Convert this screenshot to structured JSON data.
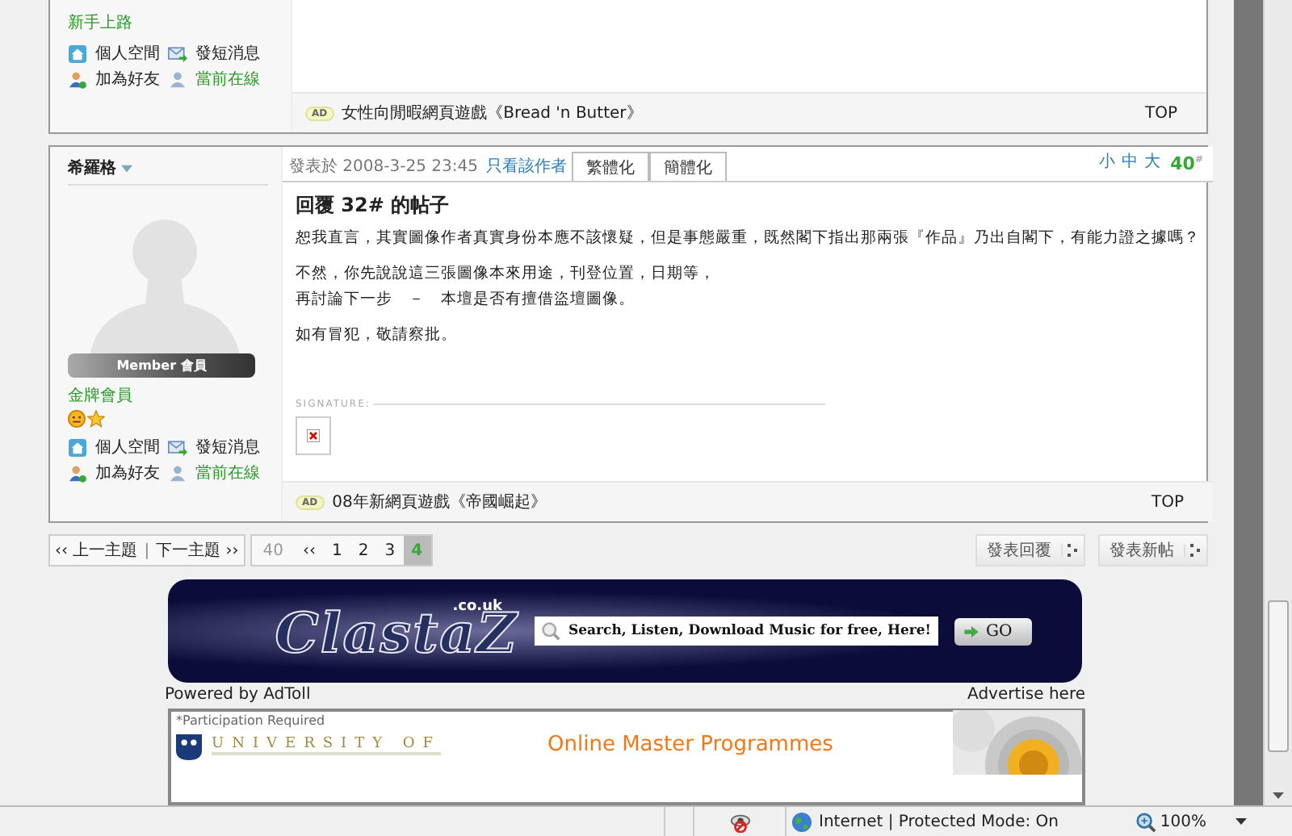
{
  "prev_post": {
    "rank": "新手上路",
    "actions": [
      {
        "kind": "home",
        "label": "個人空間"
      },
      {
        "kind": "mail",
        "label": "發短消息"
      },
      {
        "kind": "add",
        "label": "加為好友"
      },
      {
        "kind": "online",
        "label": "當前在線"
      }
    ],
    "ad": {
      "badge": "AD",
      "text": "女性向閒暇網頁遊戲《Bread 'n Butter》"
    },
    "top": "TOP"
  },
  "post": {
    "author": "希羅格",
    "posted": "發表於 2008-3-25 23:45",
    "author_only": "只看該作者",
    "convert_tabs": [
      "繁體化",
      "簡體化"
    ],
    "font_sizes": [
      "小",
      "中",
      "大"
    ],
    "floor": "40",
    "floor_mark": "#",
    "rank_badge": "Member 會員",
    "rank": "金牌會員",
    "actions": [
      {
        "kind": "home",
        "label": "個人空間"
      },
      {
        "kind": "mail",
        "label": "發短消息"
      },
      {
        "kind": "add",
        "label": "加為好友"
      },
      {
        "kind": "online",
        "label": "當前在線"
      }
    ],
    "title": "回覆 32# 的帖子",
    "paragraphs": [
      [
        "恕我直言，其實圖像作者真實身份本應不該懷疑，但是事態嚴重，既然閣下指出那兩張『作品』乃出自閣下，有能力證之據嗎？"
      ],
      [
        "不然，你先說說這三張圖像本來用途，刊登位置，日期等，",
        "再討論下一步　－　本壇是否有擅借盜壇圖像。"
      ],
      [
        "如有冒犯，敬請察批。"
      ]
    ],
    "signature_label": "SIGNATURE:",
    "ad": {
      "badge": "AD",
      "text": "08年新網頁遊戲《帝國崛起》"
    },
    "top": "TOP"
  },
  "thread_nav": [
    "‹‹ 上一主題",
    "下一主題 ››"
  ],
  "thread_nav_separator": "|",
  "pagination": {
    "total": "40",
    "first": "‹‹",
    "pages": [
      {
        "label": "1",
        "selected": false
      },
      {
        "label": "2",
        "selected": false
      },
      {
        "label": "3",
        "selected": false
      },
      {
        "label": "4",
        "selected": true
      }
    ]
  },
  "buttons": [
    "發表回覆",
    "發表新帖"
  ],
  "banner": {
    "logo": "ClastaZ",
    "domain": ".co.uk",
    "search": "Search, Listen, Download Music for free, Here!",
    "go": "GO"
  },
  "powered": "Powered by AdToll",
  "advertise": "Advertise here",
  "promo": {
    "note": "*Participation Required",
    "org": "UNIVERSITY OF",
    "headline": "Online Master Programmes"
  },
  "status_bar": {
    "zone": "Internet | Protected Mode: On",
    "zoom": "100%"
  }
}
